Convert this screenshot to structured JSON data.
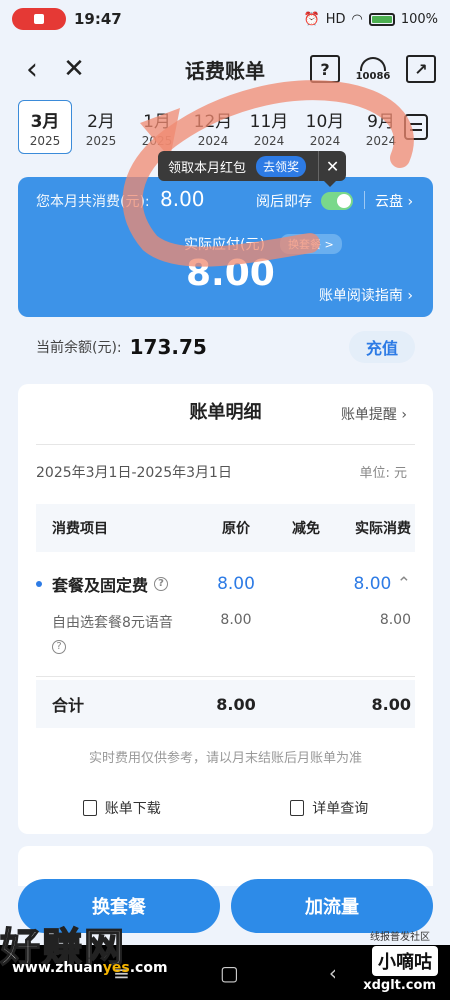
{
  "status": {
    "time": "19:47",
    "battery": "100%",
    "signal": "HD"
  },
  "nav": {
    "title": "话费账单",
    "help_label": "?",
    "hotline": "10086"
  },
  "months": [
    {
      "m": "3月",
      "y": "2025",
      "active": true
    },
    {
      "m": "2月",
      "y": "2025"
    },
    {
      "m": "1月",
      "y": "2025"
    },
    {
      "m": "12月",
      "y": "2024"
    },
    {
      "m": "11月",
      "y": "2024"
    },
    {
      "m": "10月",
      "y": "2024"
    },
    {
      "m": "9月",
      "y": "2024"
    }
  ],
  "tooltip": {
    "text": "领取本月红包",
    "go": "去领奖",
    "close": "✕"
  },
  "card": {
    "consumed_label": "您本月共消费(元):",
    "consumed_value": "8.00",
    "read_save": "阅后即存",
    "cloud": "云盘 ›",
    "payable_label": "实际应付(元)",
    "switch_plan": "换套餐 >",
    "payable_value": "8.00",
    "guide": "账单阅读指南 ›"
  },
  "balance": {
    "label": "当前余额(元):",
    "value": "173.75",
    "recharge": "充值"
  },
  "detail": {
    "title": "账单明细",
    "remind": "账单提醒 ›",
    "range": "2025年3月1日-2025年3月1日",
    "unit": "单位: 元",
    "headers": [
      "消费项目",
      "原价",
      "减免",
      "实际消费"
    ],
    "main_row": {
      "name": "套餐及固定费",
      "orig": "8.00",
      "reduce": "",
      "actual": "8.00"
    },
    "sub_row": {
      "name": "自由选套餐8元语音",
      "orig": "8.00",
      "reduce": "",
      "actual": "8.00"
    },
    "total": {
      "name": "合计",
      "orig": "8.00",
      "reduce": "",
      "actual": "8.00"
    },
    "note": "实时费用仅供参考，请以月末结账后月账单为准",
    "download": "账单下载",
    "query": "详单查询"
  },
  "buttons": {
    "change_plan": "换套餐",
    "add_data": "加流量"
  },
  "watermark": {
    "site": "好赚网",
    "url_pre": "www.zhuan",
    "url_mid": "yes",
    "url_post": ".com",
    "right_name": "小嘀咕",
    "right_url": "xdglt.com",
    "right_tag": "线报普发社区"
  }
}
